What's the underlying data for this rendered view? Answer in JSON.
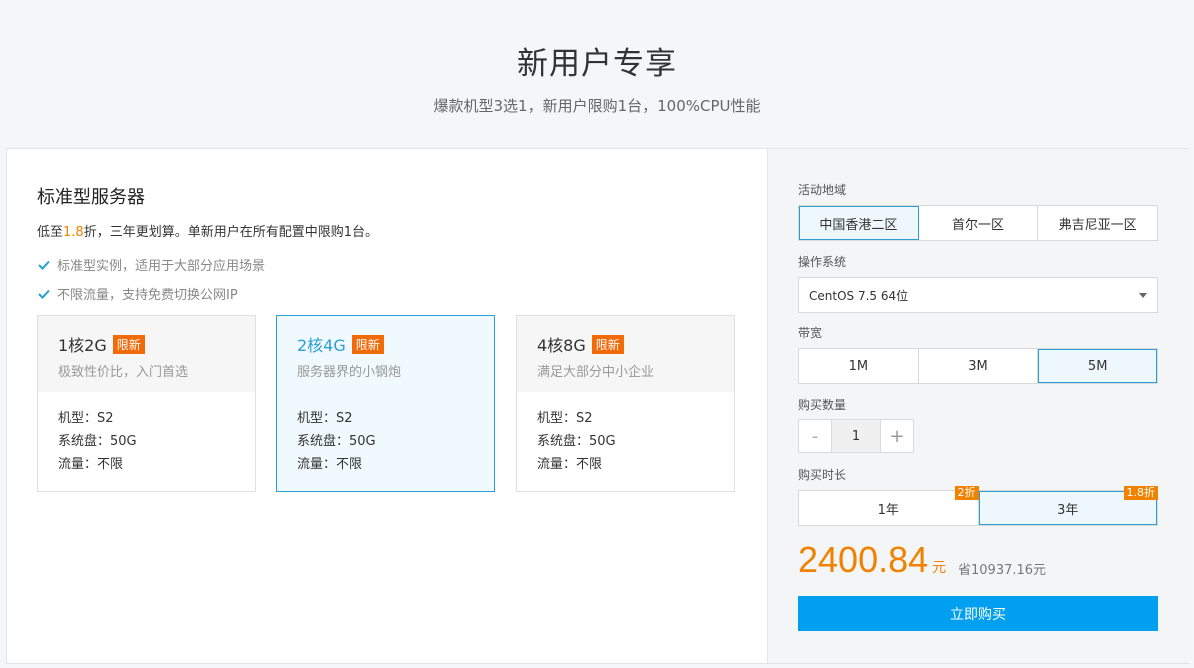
{
  "hero": {
    "title": "新用户专享",
    "subtitle": "爆款机型3选1，新用户限购1台，100%CPU性能"
  },
  "left": {
    "title": "标准型服务器",
    "desc_prefix": "低至",
    "desc_highlight": "1.8",
    "desc_suffix": "折，三年更划算。单新用户在所有配置中限购1台。",
    "features": [
      "标准型实例，适用于大部分应用场景",
      "不限流量，支持免费切换公网IP"
    ],
    "cards": [
      {
        "name": "1核2G",
        "badge": "限新",
        "tagline": "极致性价比，入门首选",
        "spec_model": "机型：S2",
        "spec_disk": "系统盘：50G",
        "spec_traffic": "流量：不限"
      },
      {
        "name": "2核4G",
        "badge": "限新",
        "tagline": "服务器界的小钢炮",
        "spec_model": "机型：S2",
        "spec_disk": "系统盘：50G",
        "spec_traffic": "流量：不限"
      },
      {
        "name": "4核8G",
        "badge": "限新",
        "tagline": "满足大部分中小企业",
        "spec_model": "机型：S2",
        "spec_disk": "系统盘：50G",
        "spec_traffic": "流量：不限"
      }
    ],
    "selected_card": 1
  },
  "right": {
    "region_label": "活动地域",
    "regions": [
      "中国香港二区",
      "首尔一区",
      "弗吉尼亚一区"
    ],
    "os_label": "操作系统",
    "os_value": "CentOS 7.5 64位",
    "bandwidth_label": "带宽",
    "bandwidths": [
      "1M",
      "3M",
      "5M"
    ],
    "qty_label": "购买数量",
    "qty_minus": "-",
    "qty_value": "1",
    "qty_plus": "+",
    "duration_label": "购买时长",
    "durations": [
      {
        "label": "1年",
        "discount": "2折"
      },
      {
        "label": "3年",
        "discount": "1.8折"
      }
    ],
    "price": "2400.84",
    "price_unit": "元",
    "save_text": "省10937.16元",
    "buy_label": "立即购买"
  },
  "colors": {
    "accent": "#009ff0",
    "selected_border": "#2a9fd6",
    "orange": "#f08200",
    "badge": "#f26b0a"
  }
}
